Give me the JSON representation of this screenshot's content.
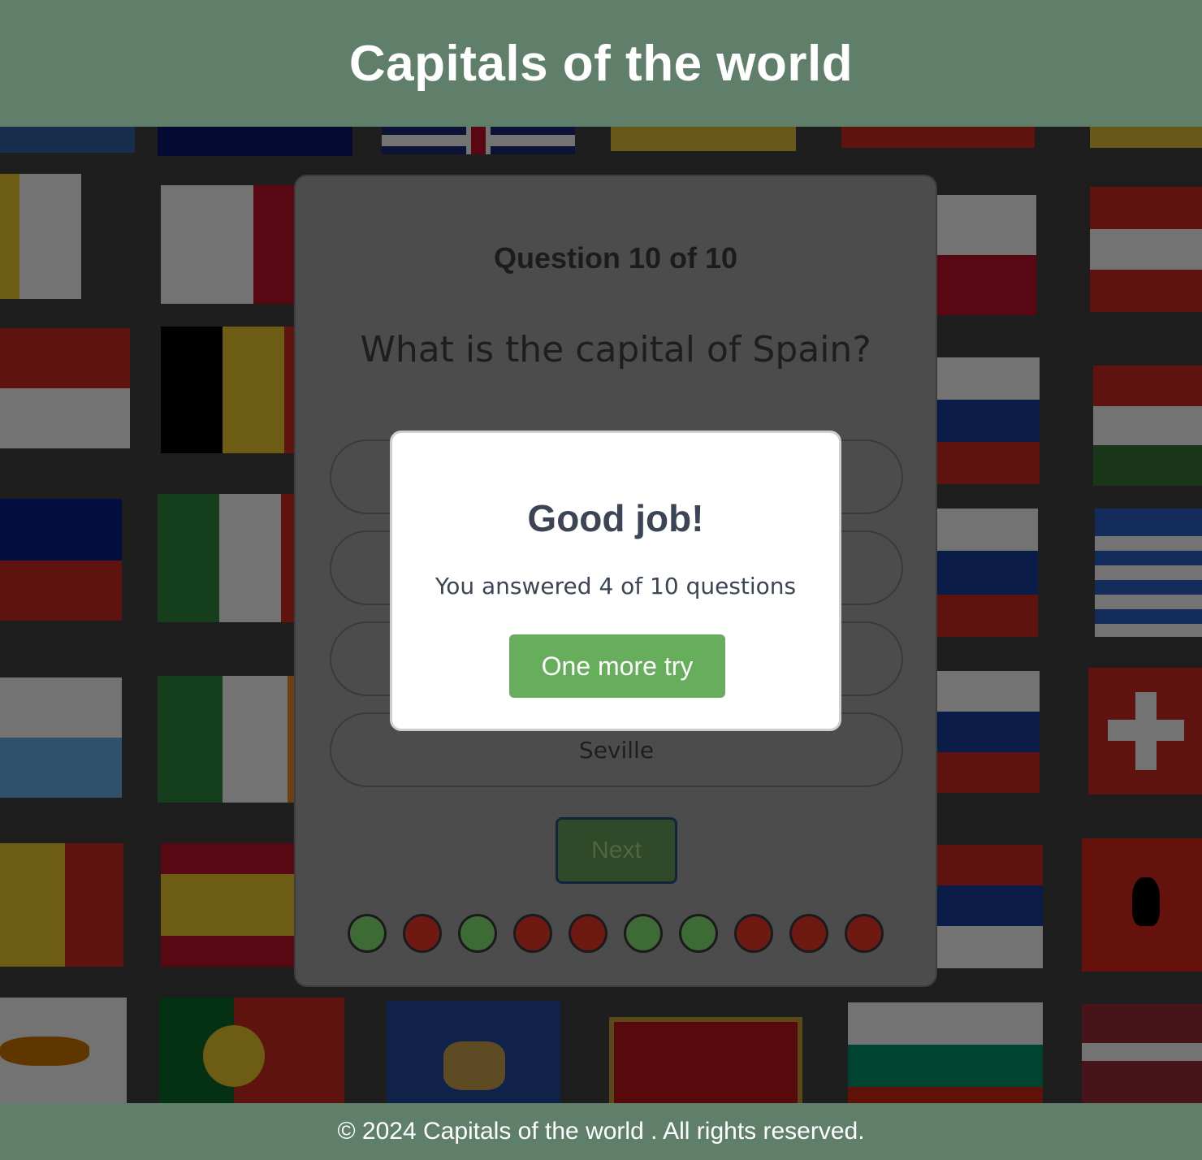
{
  "header": {
    "title": "Capitals of the world"
  },
  "quiz": {
    "question_number": "Question 10 of 10",
    "question_text": "What is the capital of Spain?",
    "answers": [
      "",
      "",
      "",
      "Seville"
    ],
    "next_label": "Next",
    "progress": [
      "correct",
      "wrong",
      "correct",
      "wrong",
      "wrong",
      "correct",
      "correct",
      "wrong",
      "wrong",
      "wrong"
    ]
  },
  "modal": {
    "title": "Good job!",
    "text": "You answered 4 of 10 questions",
    "button_label": "One more try"
  },
  "footer": {
    "text": "© 2024 Capitals of the world . All rights reserved."
  },
  "colors": {
    "header_bg": "#5f7f6b",
    "correct": "#3d6a35",
    "wrong": "#6e1a12",
    "retry_button": "#66ae5b"
  }
}
